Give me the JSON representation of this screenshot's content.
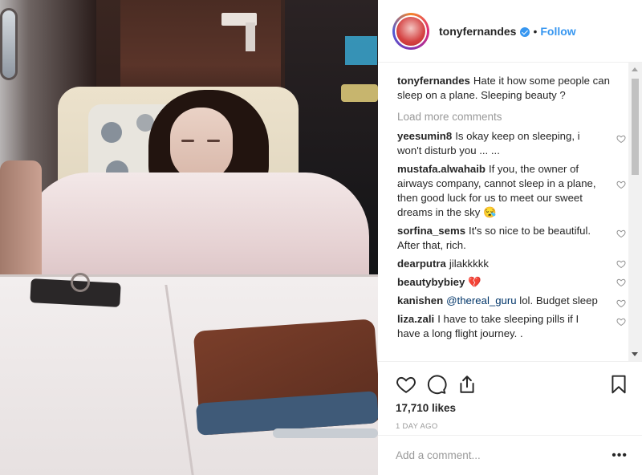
{
  "post": {
    "username": "tonyfernandes",
    "follow_label": "Follow",
    "separator": "•",
    "caption_user": "tonyfernandes",
    "caption_text": "Hate it how some people can sleep on a plane. Sleeping beauty ?",
    "load_more": "Load more comments",
    "comments": [
      {
        "user": "yeesumin8",
        "text": "Is okay keep on sleeping, i won't disturb you ... ..."
      },
      {
        "user": "mustafa.alwahaib",
        "text": "If you, the owner of airways company, cannot sleep in a plane, then good luck for us to meet our sweet dreams in the sky 😪"
      },
      {
        "user": "sorfina_sems",
        "text": "It's so nice to be beautiful. After that, rich."
      },
      {
        "user": "dearputra",
        "text": "jilakkkkk"
      },
      {
        "user": "beautybybiey",
        "text": "💔"
      },
      {
        "user": "kanishen",
        "mention": "@thereal_guru",
        "text": "lol. Budget sleep"
      },
      {
        "user": "liza.zali",
        "text": "I have to take sleeping pills if I have a long flight journey. ."
      }
    ],
    "likes": "17,710 likes",
    "time": "1 DAY AGO",
    "add_comment_placeholder": "Add a comment...",
    "more_label": "•••"
  },
  "colors": {
    "accent": "#3897f0",
    "text": "#262626",
    "muted": "#999999"
  },
  "icons": [
    "verified-badge-icon",
    "heart-icon",
    "comment-icon",
    "share-icon",
    "bookmark-icon",
    "more-options-icon"
  ]
}
